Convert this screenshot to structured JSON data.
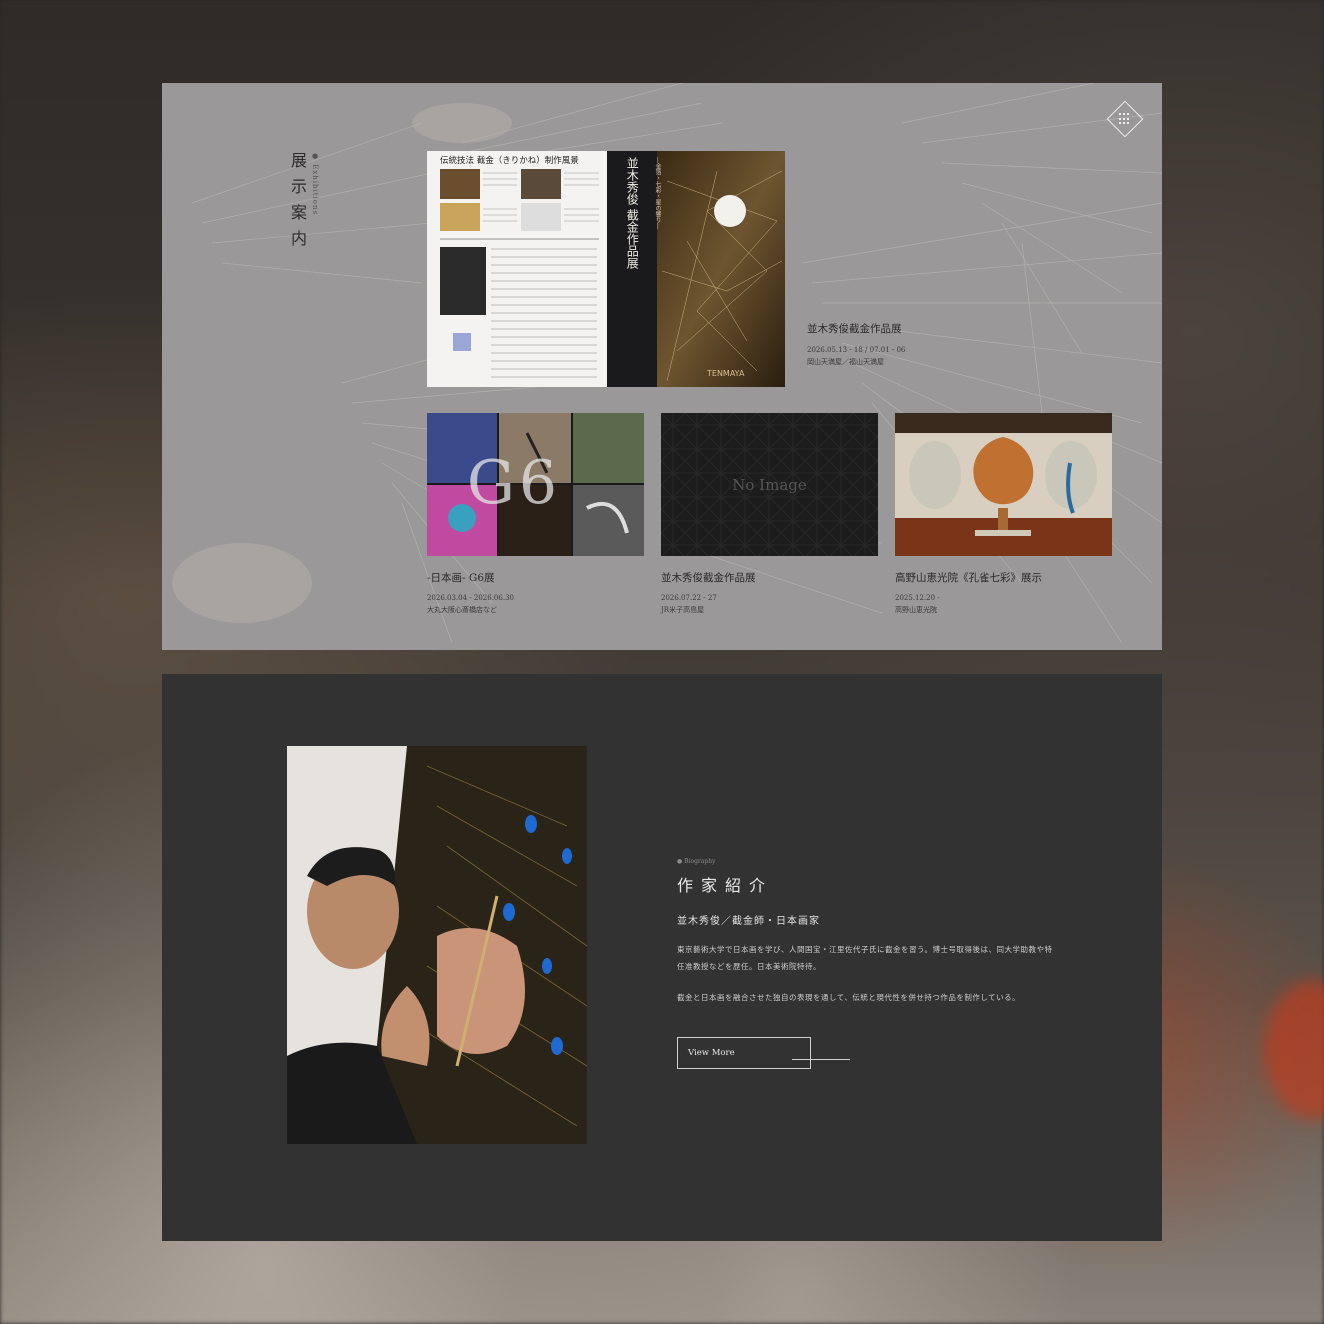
{
  "exhibitions": {
    "title": "展示案内",
    "subtitle": "● Exhibitions",
    "featured": {
      "flyer_left_title": "伝統技法 截金（きりかね）制作風景",
      "flyer_vertical_title": "並木秀俊 截金作品展",
      "flyer_vertical_sub": "―金箔・七彩・星の響り―",
      "title": "並木秀俊截金作品展",
      "date": "2026.05.13 - 18 / 07.01 - 06",
      "venue": "岡山天満屋／福山天満屋"
    },
    "cards": [
      {
        "title": "-日本画- G6展",
        "date": "2026.03.04 - 2026.06.30",
        "venue": "大丸大阪心斎橋店など",
        "overlay": "G6"
      },
      {
        "title": "並木秀俊截金作品展",
        "date": "2026.07.22 - 27",
        "venue": "JR米子高島屋",
        "overlay": "No Image"
      },
      {
        "title": "高野山恵光院《孔雀七彩》展示",
        "date": "2025.12.20 -",
        "venue": "高野山恵光院",
        "overlay": ""
      }
    ]
  },
  "biography": {
    "label": "● Biography",
    "title": "作家紹介",
    "name": "並木秀俊／截金師・日本画家",
    "paragraph1": "東京藝術大学で日本画を学び、人間国宝・江里佐代子氏に截金を習う。博士号取得後は、同大学助教や特任准教授などを歴任。日本美術院特待。",
    "paragraph2": "截金と日本画を融合させた独自の表現を通して、伝統と現代性を併せ持つ作品を制作している。",
    "button": "View More"
  },
  "colors": {
    "exhibitions_bg": "#9a9898",
    "biography_bg": "#323232"
  }
}
